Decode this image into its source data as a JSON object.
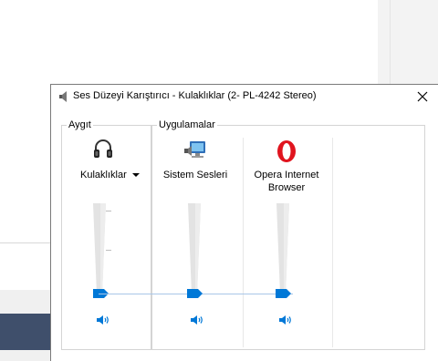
{
  "dialog": {
    "title": "Ses Düzeyi Karıştırıcı - Kulaklıklar (2- PL-4242 Stereo)"
  },
  "device": {
    "group_label": "Aygıt",
    "name": "Kulaklıklar",
    "icon": "headphones-icon",
    "volume_percent": 0
  },
  "applications": {
    "group_label": "Uygulamalar",
    "items": [
      {
        "label": "Sistem Sesleri",
        "icon": "system-sounds-icon",
        "volume_percent": 0
      },
      {
        "label": "Opera Internet Browser",
        "icon": "opera-icon",
        "volume_percent": 0
      }
    ]
  },
  "colors": {
    "accent": "#0078d7",
    "track": "#e6e6e6",
    "opera_red": "#e0141e"
  }
}
